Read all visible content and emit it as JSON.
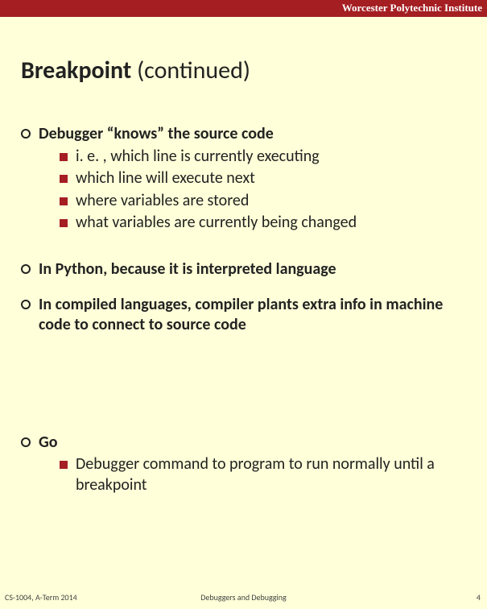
{
  "header": {
    "institution": "Worcester Polytechnic Institute"
  },
  "title": {
    "main": "Breakpoint",
    "suffix": "(continued)"
  },
  "points": [
    {
      "text": "Debugger “knows” the source code",
      "bold": true,
      "sub": [
        "i. e. , which line is currently executing",
        "which line will execute next",
        "where variables are stored",
        "what variables are currently being changed"
      ]
    },
    {
      "text": "In Python, because it is interpreted language",
      "bold": true
    },
    {
      "text": "In compiled languages, compiler plants extra info in machine code to connect to source code",
      "bold": true
    },
    {
      "text": "Go",
      "bold": true,
      "sub": [
        "Debugger command to program to run normally until a breakpoint"
      ]
    }
  ],
  "footer": {
    "left": "CS-1004, A-Term 2014",
    "center": "Debuggers and Debugging",
    "right": "4"
  }
}
